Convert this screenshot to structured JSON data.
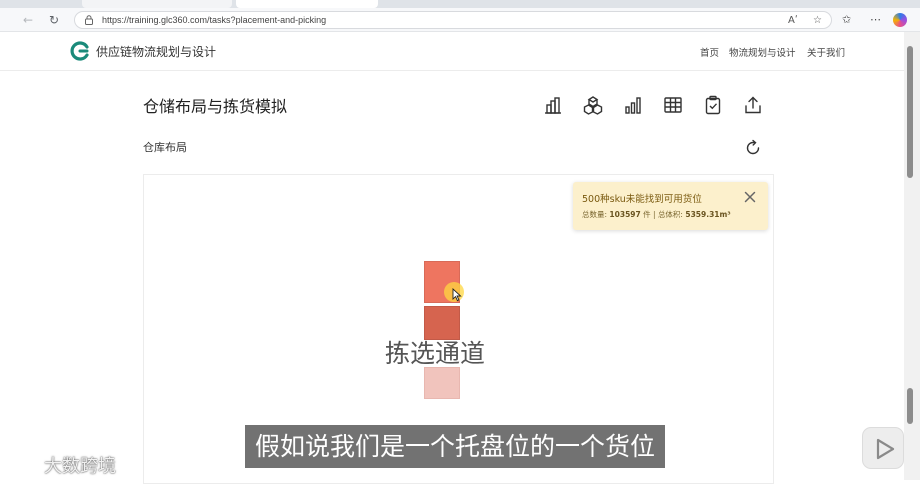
{
  "browser": {
    "url": "https://training.glc360.com/tasks?placement-and-picking",
    "reader_mode_label": "Aʹ"
  },
  "site": {
    "name": "供应链物流规划与设计",
    "nav": [
      "首页",
      "物流规划与设计",
      "关于我们"
    ]
  },
  "page": {
    "title": "仓储布局与拣货模拟",
    "section_title": "仓库布局",
    "toolbar_icons": [
      "building-icon",
      "boxes-icon",
      "bar-chart-icon",
      "table-icon",
      "clipboard-check-icon",
      "export-icon"
    ]
  },
  "toast": {
    "title": "500种sku未能找到可用货位",
    "qty_label": "总数量:",
    "qty_value": "103597",
    "qty_unit": "件",
    "separator": "|",
    "vol_label": "总体积:",
    "vol_value": "5359.31m³"
  },
  "layout_canvas": {
    "aisle_label": "拣选通道",
    "slots": [
      {
        "color": "#ee7560"
      },
      {
        "color": "#d6644f"
      },
      {
        "color": "#f1c4bd"
      }
    ]
  },
  "video_overlay": {
    "subtitle": "假如说我们是一个托盘位的一个货位",
    "watermark": "大数跨境"
  },
  "colors": {
    "accent": "#1a8a7a",
    "toast_bg": "#fcf0cc"
  }
}
